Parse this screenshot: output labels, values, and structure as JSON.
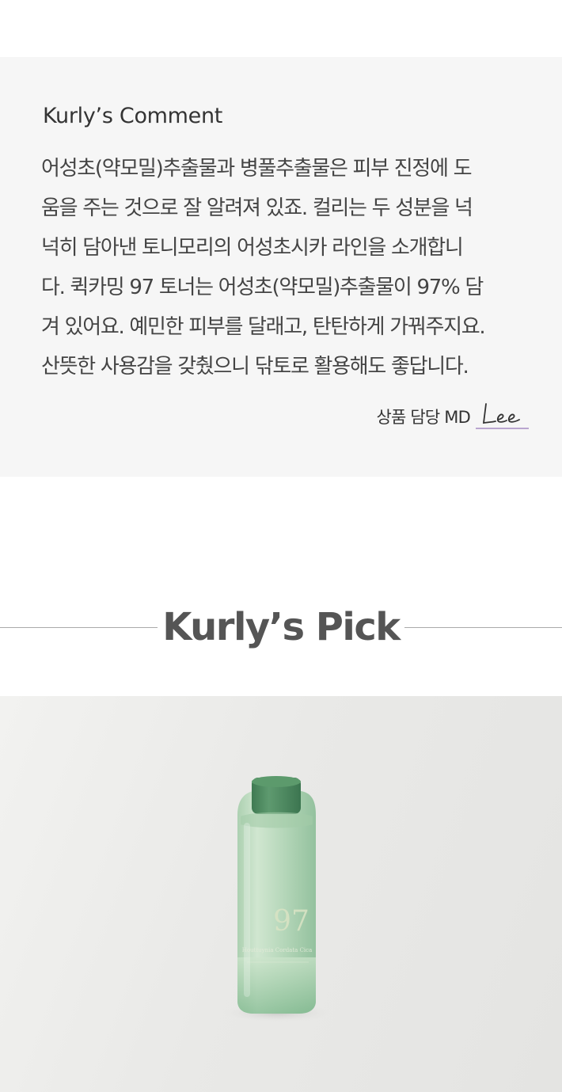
{
  "comment": {
    "title": "Kurly’s Comment",
    "lines": [
      "어성초(약모밀)추출물과 병풀추출물은 피부 진정에 도",
      "움을 주는 것으로 잘 알려져 있죠. 컬리는 두 성분을 넉",
      "넉히 담아낸 토니모리의 어성초시카 라인을 소개합니",
      "다. 퀵카밍 97 토너는 어성초(약모밀)추출물이 97% 담",
      "겨 있어요. 예민한 피부를 달래고, 탄탄하게 가꿔주지요.",
      "산뜻한 사용감을 갖췄으니 닦토로 활용해도 좋답니다."
    ],
    "md_label": "상품 담당 MD",
    "signature": "Lee",
    "signature_underline_color": "#a58bc4"
  },
  "pick": {
    "title": "Kurly’s Pick"
  },
  "product": {
    "bottle_label_number": "97",
    "bottle_label_text": "Houttuynia Cordata Cica",
    "bottle_color": "#8fbf9a",
    "cap_color": "#4e8a61"
  }
}
